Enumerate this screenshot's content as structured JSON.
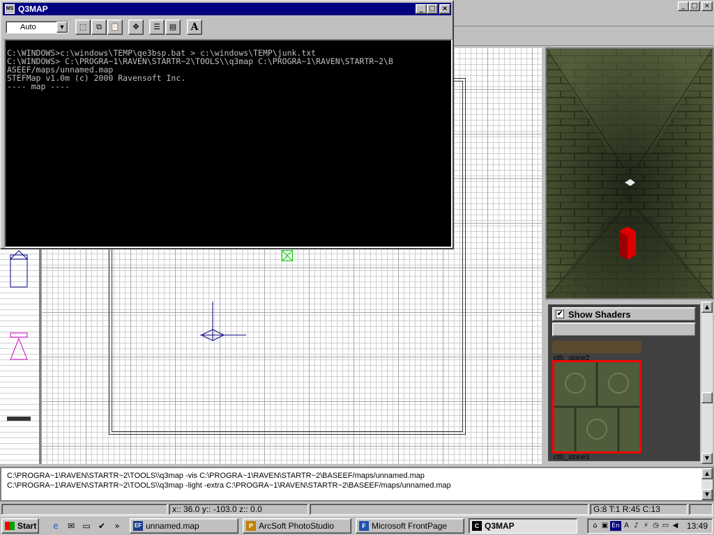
{
  "q3map_window": {
    "title": "Q3MAP",
    "app_icon": "MS-DOS",
    "toolbar": {
      "font_size": "Auto"
    },
    "console_lines": [
      "",
      "C:\\WINDOWS>c:\\windows\\TEMP\\qe3bsp.bat > c:\\windows\\TEMP\\junk.txt",
      "",
      "C:\\WINDOWS> C:\\PROGRA~1\\RAVEN\\STARTR~2\\TOOLS\\\\q3map C:\\PROGRA~1\\RAVEN\\STARTR~2\\B",
      "ASEEF/maps/unnamed.map",
      "STEFMap v1.0m (c) 2000 Ravensoft Inc.",
      "---- map ----"
    ]
  },
  "texture_browser": {
    "show_shaders_label": "Show Shaders",
    "show_shaders_checked": true,
    "textures": [
      "ctfc_stone2",
      "ctfc_stone3"
    ],
    "selected_texture": "ctfc_stone3",
    "highlight_color": "#ff0000"
  },
  "console_log": {
    "lines": [
      "C:\\PROGRA~1\\RAVEN\\STARTR~2\\TOOLS\\\\q3map -vis C:\\PROGRA~1\\RAVEN\\STARTR~2\\BASEEF/maps/unnamed.map",
      "C:\\PROGRA~1\\RAVEN\\STARTR~2\\TOOLS\\\\q3map -light -extra C:\\PROGRA~1\\RAVEN\\STARTR~2\\BASEEF/maps/unnamed.map"
    ]
  },
  "status_bar": {
    "coords": "x:: 36.0  y:: -103.0  z:: 0.0",
    "grid_info": "G:8 T:1 R:45 C:13"
  },
  "taskbar": {
    "start_label": "Start",
    "tasks": [
      {
        "label": "unnamed.map",
        "icon": "EF"
      },
      {
        "label": "ArcSoft PhotoStudio",
        "icon": "ps-icon"
      },
      {
        "label": "Microsoft FrontPage",
        "icon": "fp-icon"
      },
      {
        "label": "Q3MAP",
        "icon": "msdos-icon"
      }
    ],
    "tray_language": "En",
    "clock": "13:49"
  }
}
